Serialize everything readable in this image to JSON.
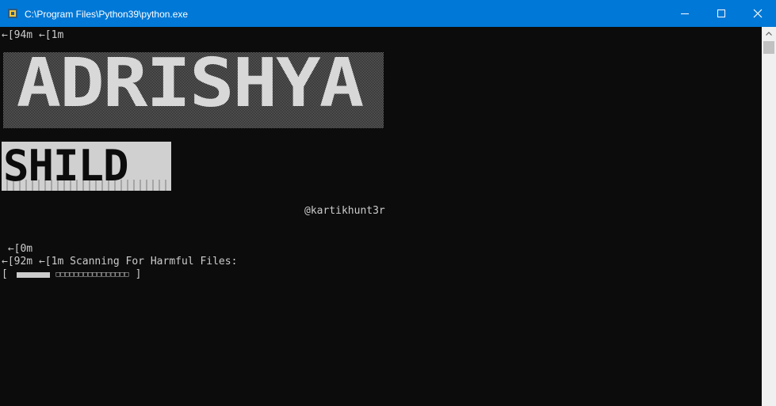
{
  "window": {
    "title": "C:\\Program Files\\Python39\\python.exe",
    "app_icon": "python-icon",
    "controls": {
      "minimize_icon": "minimize-icon",
      "maximize_icon": "maximize-icon",
      "close_icon": "close-icon"
    },
    "titlebar_color": "#0078d7"
  },
  "console": {
    "background": "#0c0c0c",
    "text_color": "#cccccc",
    "lines": {
      "esc_color": "←[94m ←[1m",
      "handle": "@kartikhunt3r",
      "esc_reset": " ←[0m",
      "scan": "←[92m ←[1m Scanning For Harmful Files:"
    },
    "banner": {
      "line1": "ADRISHYA",
      "line2": "SHILD"
    },
    "progress": {
      "open": "[",
      "close": "]",
      "fraction_complete": 0.19,
      "remaining_glyphs": "□□□□□□□□□□□□□□□□"
    }
  },
  "scrollbar": {
    "up_icon": "chevron-up-icon"
  }
}
